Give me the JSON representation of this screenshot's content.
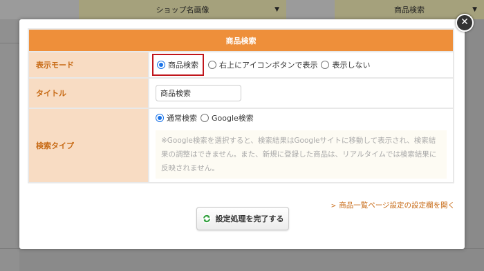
{
  "background": {
    "header_left": "ショップ名画像",
    "header_right": "商品検索"
  },
  "modal": {
    "header": "商品検索",
    "rows": {
      "display_mode": {
        "label": "表示モード",
        "options": [
          "商品検索",
          "右上にアイコンボタンで表示",
          "表示しない"
        ],
        "selected": "商品検索"
      },
      "title": {
        "label": "タイトル",
        "value": "商品検索"
      },
      "search_type": {
        "label": "検索タイプ",
        "options": [
          "通常検索",
          "Google検索"
        ],
        "selected": "通常検索",
        "note": "※Google検索を選択すると、検索結果はGoogleサイトに移動して表示され、検索結果の調整はできません。また、新規に登録した商品は、リアルタイムでは検索結果に反映されません。"
      }
    },
    "open_link": "商品一覧ページ設定の設定欄を開く",
    "complete_button": "設定処理を完了する"
  },
  "colors": {
    "header_orange": "#ee8f3a",
    "label_bg": "#f8dcc3",
    "label_text": "#c76a15",
    "radio_selected": "#1a73e8",
    "highlight_border": "#c0161c"
  }
}
